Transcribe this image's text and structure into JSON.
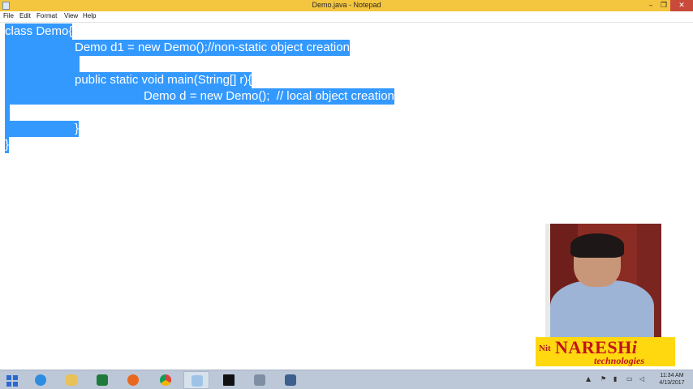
{
  "window": {
    "title": "Demo.java - Notepad",
    "controls": {
      "minimize": "–",
      "maximize": "❐",
      "close": "✕"
    }
  },
  "menu": {
    "items": [
      "File",
      "Edit",
      "Format",
      "View",
      "Help"
    ]
  },
  "editor": {
    "lines": [
      "class Demo{",
      "\t\tDemo d1 = new Demo();//non-static object creation",
      "",
      "\t\tpublic static void main(String[] r){",
      "\t\t\t\tDemo d = new Demo();  // local object creation",
      "",
      "\t\t\t\t}",
      "}"
    ],
    "selection": "all"
  },
  "overlay": {
    "logo_mark": "Nit",
    "logo_name": "NARESH",
    "logo_suffix": "i",
    "logo_sub": "technologies"
  },
  "taskbar": {
    "apps": [
      "start",
      "internet-explorer",
      "file-explorer",
      "excel",
      "firefox",
      "chrome",
      "notepad",
      "command-prompt",
      "network-tool",
      "remote-tool"
    ],
    "clock_time": "11:34 AM",
    "clock_date": "4/13/2017"
  },
  "colors": {
    "title_bar": "#f4c53e",
    "selection": "#3399ff",
    "taskbar": "#bcc8d8",
    "logo_bg": "#ffd80f",
    "logo_text": "#c0141b"
  }
}
